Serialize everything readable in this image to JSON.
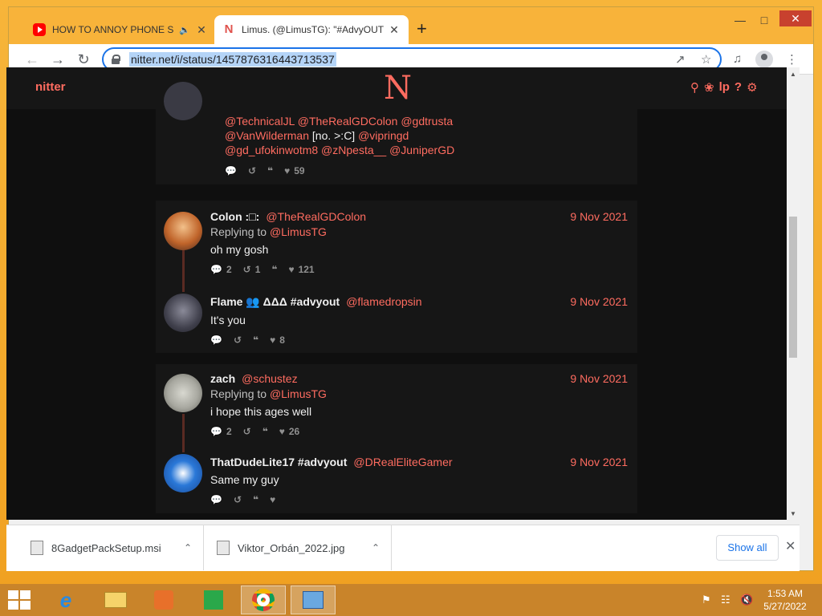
{
  "browser": {
    "tabs": [
      {
        "title": "HOW TO ANNOY PHONE SC",
        "favicon": "youtube-icon",
        "audio": true
      },
      {
        "title": "Limus. (@LimusTG): \"#AdvyOUT",
        "favicon": "nitter-n-icon",
        "active": true
      }
    ],
    "new_tab_label": "+",
    "address": "nitter.net/i/status/1457876316443713537"
  },
  "nitter": {
    "brand": "nitter",
    "logo": "N"
  },
  "partial_tweet": {
    "mentions_line1": "@TechnicalJL @TheRealGDColon @gdtrusta",
    "mentions_line2_a": "@VanWilderman",
    "mentions_line2_plain": " [no. >:C] ",
    "mentions_line2_b": "@vipringd",
    "mentions_line3": "@gd_ufokinwotm8 @zNpesta__ @JuniperGD",
    "likes": "59"
  },
  "threads": [
    {
      "tweets": [
        {
          "fullname": "Colon :□:",
          "username": "@TheRealGDColon",
          "date": "9 Nov 2021",
          "replying_label": "Replying to",
          "replying_to": "@LimusTG",
          "text": "oh my gosh",
          "replies": "2",
          "retweets": "1",
          "quotes": "",
          "likes": "121"
        },
        {
          "fullname": "Flame 👥 ΔΔΔ #advyout",
          "username": "@flamedropsin",
          "date": "9 Nov 2021",
          "text": "It's you",
          "replies": "",
          "retweets": "",
          "quotes": "",
          "likes": "8"
        }
      ]
    },
    {
      "tweets": [
        {
          "fullname": "zach",
          "username": "@schustez",
          "date": "9 Nov 2021",
          "replying_label": "Replying to",
          "replying_to": "@LimusTG",
          "text": "i hope this ages well",
          "replies": "2",
          "retweets": "",
          "quotes": "",
          "likes": "26"
        },
        {
          "fullname": "ThatDudeLite17 #advyout",
          "username": "@DRealEliteGamer",
          "date": "9 Nov 2021",
          "text": "Same my guy",
          "replies": "",
          "retweets": "",
          "quotes": "",
          "likes": ""
        }
      ]
    }
  ],
  "downloads": {
    "items": [
      "8GadgetPackSetup.msi",
      "Viktor_Orbán_2022.jpg"
    ],
    "show_all": "Show all"
  },
  "taskbar": {
    "time": "1:53 AM",
    "date": "5/27/2022"
  },
  "colors": {
    "accent": "#ff6c60",
    "background": "#0f0f0f",
    "panel": "#161616"
  }
}
